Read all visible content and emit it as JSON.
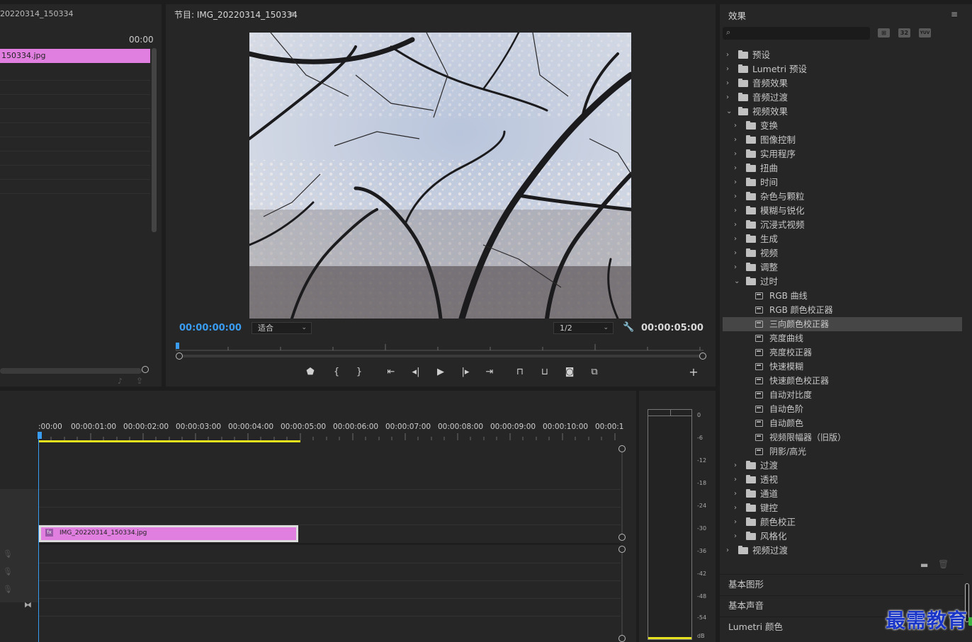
{
  "source_panel": {
    "title": "20220314_150334",
    "timecode": "00:00",
    "clip_label": "150334.jpg"
  },
  "program": {
    "title": "节目: IMG_20220314_150334",
    "menu_glyph": "≡",
    "current_tc": "00:00:00:00",
    "fit_label": "适合",
    "resolution_label": "1/2",
    "duration_tc": "00:00:05:00"
  },
  "timeline": {
    "ruler_labels": [
      ":00:00",
      "00:00:01:00",
      "00:00:02:00",
      "00:00:03:00",
      "00:00:04:00",
      "00:00:05:00",
      "00:00:06:00",
      "00:00:07:00",
      "00:00:08:00",
      "00:00:09:00",
      "00:00:10:00",
      "00:00:1"
    ],
    "clip_name": "IMG_20220314_150334.jpg",
    "fx_badge": "fx"
  },
  "meter": {
    "ticks": [
      "0",
      "-6",
      "-12",
      "-18",
      "-24",
      "-30",
      "-36",
      "-42",
      "-48",
      "-54",
      "dB"
    ]
  },
  "effects": {
    "title": "效果",
    "menu_glyph": "≡",
    "buttons": [
      "⊞",
      "32",
      "YUV"
    ],
    "tree": [
      {
        "label": "预设",
        "level": 0,
        "kind": "special-folder",
        "open": false
      },
      {
        "label": "Lumetri 预设",
        "level": 0,
        "kind": "special-folder",
        "open": false
      },
      {
        "label": "音频效果",
        "level": 0,
        "kind": "folder",
        "open": false
      },
      {
        "label": "音频过渡",
        "level": 0,
        "kind": "folder",
        "open": false
      },
      {
        "label": "视频效果",
        "level": 0,
        "kind": "folder",
        "open": true
      },
      {
        "label": "变换",
        "level": 1,
        "kind": "folder",
        "open": false
      },
      {
        "label": "图像控制",
        "level": 1,
        "kind": "folder",
        "open": false
      },
      {
        "label": "实用程序",
        "level": 1,
        "kind": "folder",
        "open": false
      },
      {
        "label": "扭曲",
        "level": 1,
        "kind": "folder",
        "open": false
      },
      {
        "label": "时间",
        "level": 1,
        "kind": "folder",
        "open": false
      },
      {
        "label": "杂色与颗粒",
        "level": 1,
        "kind": "folder",
        "open": false
      },
      {
        "label": "模糊与锐化",
        "level": 1,
        "kind": "folder",
        "open": false
      },
      {
        "label": "沉浸式视频",
        "level": 1,
        "kind": "folder",
        "open": false
      },
      {
        "label": "生成",
        "level": 1,
        "kind": "folder",
        "open": false
      },
      {
        "label": "视频",
        "level": 1,
        "kind": "folder",
        "open": false
      },
      {
        "label": "调整",
        "level": 1,
        "kind": "folder",
        "open": false
      },
      {
        "label": "过时",
        "level": 1,
        "kind": "folder",
        "open": true
      },
      {
        "label": "RGB 曲线",
        "level": 2,
        "kind": "effect"
      },
      {
        "label": "RGB 颜色校正器",
        "level": 2,
        "kind": "effect"
      },
      {
        "label": "三向颜色校正器",
        "level": 2,
        "kind": "effect",
        "selected": true
      },
      {
        "label": "亮度曲线",
        "level": 2,
        "kind": "effect"
      },
      {
        "label": "亮度校正器",
        "level": 2,
        "kind": "effect"
      },
      {
        "label": "快速模糊",
        "level": 2,
        "kind": "effect"
      },
      {
        "label": "快速颜色校正器",
        "level": 2,
        "kind": "effect"
      },
      {
        "label": "自动对比度",
        "level": 2,
        "kind": "effect"
      },
      {
        "label": "自动色阶",
        "level": 2,
        "kind": "effect"
      },
      {
        "label": "自动颜色",
        "level": 2,
        "kind": "effect"
      },
      {
        "label": "视频限幅器（旧版）",
        "level": 2,
        "kind": "effect"
      },
      {
        "label": "阴影/高光",
        "level": 2,
        "kind": "effect"
      },
      {
        "label": "过渡",
        "level": 1,
        "kind": "folder",
        "open": false
      },
      {
        "label": "透视",
        "level": 1,
        "kind": "folder",
        "open": false
      },
      {
        "label": "通道",
        "level": 1,
        "kind": "folder",
        "open": false
      },
      {
        "label": "键控",
        "level": 1,
        "kind": "folder",
        "open": false
      },
      {
        "label": "颜色校正",
        "level": 1,
        "kind": "folder",
        "open": false
      },
      {
        "label": "风格化",
        "level": 1,
        "kind": "folder",
        "open": false
      },
      {
        "label": "视频过渡",
        "level": 0,
        "kind": "folder",
        "open": false
      }
    ],
    "sections": [
      "基本图形",
      "基本声音",
      "Lumetri 颜色"
    ]
  },
  "watermark": "最需教育",
  "colors": {
    "accent_blue": "#3a9cf0",
    "clip_pink": "#e07fe0",
    "work_area_yellow": "#e6e21e",
    "selection": "#464646"
  }
}
